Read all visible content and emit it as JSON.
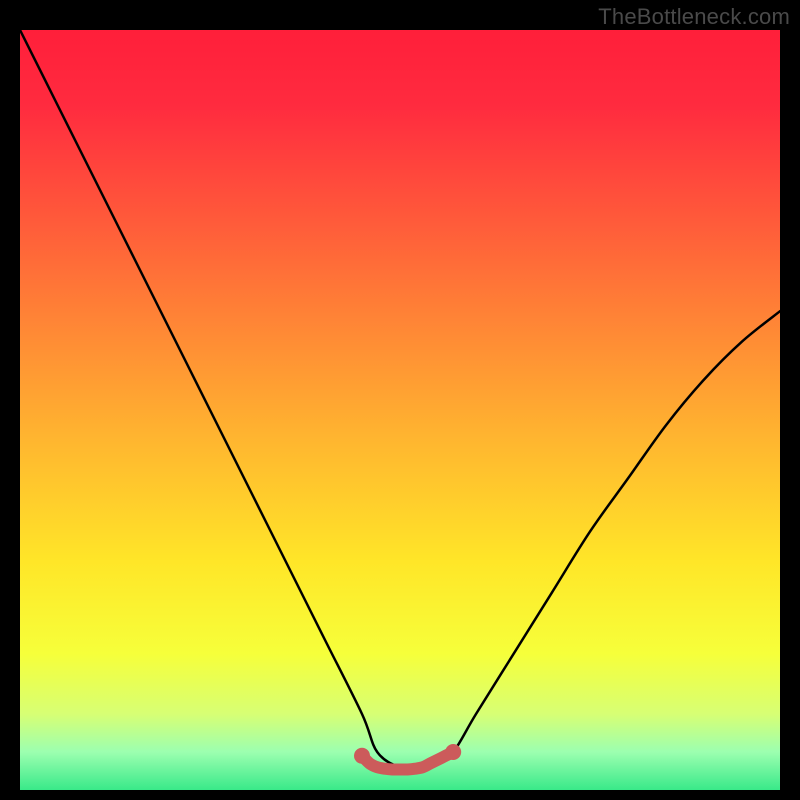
{
  "watermark": "TheBottleneck.com",
  "chart_data": {
    "type": "line",
    "title": "",
    "xlabel": "",
    "ylabel": "",
    "xlim": [
      0,
      100
    ],
    "ylim": [
      0,
      100
    ],
    "series": [
      {
        "name": "black-curve",
        "x": [
          0,
          5,
          10,
          15,
          20,
          25,
          30,
          35,
          40,
          45,
          47,
          50,
          53,
          55,
          57,
          60,
          65,
          70,
          75,
          80,
          85,
          90,
          95,
          100
        ],
        "y": [
          100,
          90,
          80,
          70,
          60,
          50,
          40,
          30,
          20,
          10,
          5,
          3,
          3,
          4,
          5,
          10,
          18,
          26,
          34,
          41,
          48,
          54,
          59,
          63
        ]
      },
      {
        "name": "red-flat-marker",
        "x": [
          45,
          46,
          47,
          48,
          49,
          50,
          51,
          52,
          53,
          54,
          55,
          56,
          57
        ],
        "y": [
          4.5,
          3.5,
          3,
          2.8,
          2.7,
          2.7,
          2.7,
          2.8,
          3,
          3.5,
          4,
          4.5,
          5
        ]
      }
    ],
    "background_gradient": {
      "stops": [
        {
          "offset": 0.0,
          "color": "#ff1f3a"
        },
        {
          "offset": 0.1,
          "color": "#ff2b3f"
        },
        {
          "offset": 0.25,
          "color": "#ff5a3a"
        },
        {
          "offset": 0.4,
          "color": "#ff8a35"
        },
        {
          "offset": 0.55,
          "color": "#ffb92f"
        },
        {
          "offset": 0.7,
          "color": "#ffe628"
        },
        {
          "offset": 0.82,
          "color": "#f6ff3a"
        },
        {
          "offset": 0.9,
          "color": "#d7ff74"
        },
        {
          "offset": 0.95,
          "color": "#9cffb0"
        },
        {
          "offset": 1.0,
          "color": "#39e989"
        }
      ]
    },
    "red_marker_color": "#cc5b5b",
    "line_color": "#000000"
  }
}
